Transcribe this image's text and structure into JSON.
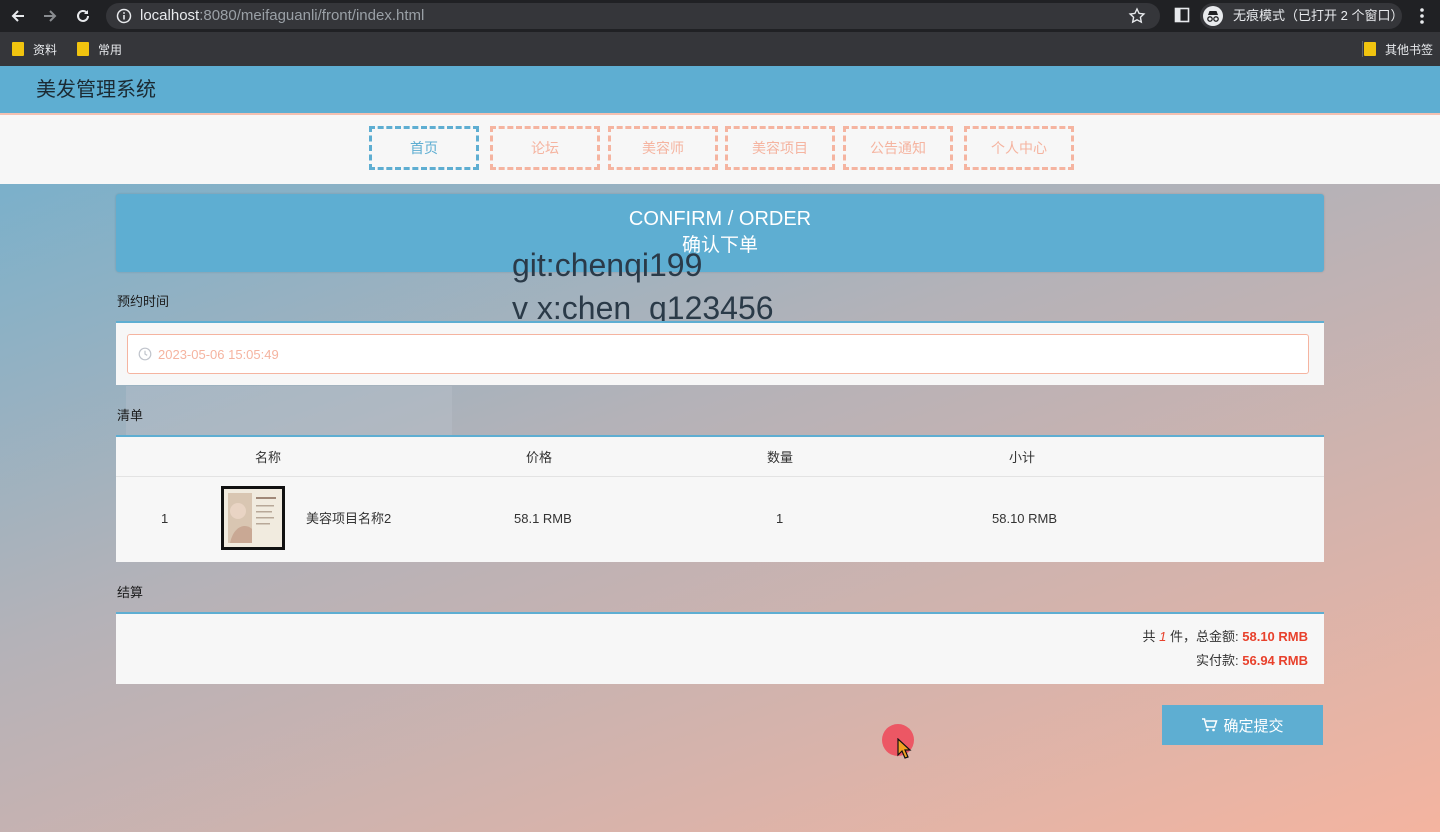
{
  "browser": {
    "url_host": "localhost",
    "url_rest": ":8080/meifaguanli/front/index.html",
    "incognito_label": "无痕模式（已打开 2 个窗口）",
    "bookmarks": [
      "资料",
      "常用"
    ],
    "other_bookmarks": "其他书签"
  },
  "site": {
    "title": "美发管理系统",
    "nav": [
      "首页",
      "论坛",
      "美容师",
      "美容项目",
      "公告通知",
      "个人中心"
    ]
  },
  "banner": {
    "en": "CONFIRM / ORDER",
    "cn": "确认下单"
  },
  "watermark": {
    "line1": "git:chenqi199",
    "line2": "v x:chen_q123456"
  },
  "appointment": {
    "label": "预约时间",
    "value": "2023-05-06 15:05:49"
  },
  "list": {
    "label": "清单",
    "headers": [
      "名称",
      "价格",
      "数量",
      "小计"
    ],
    "rows": [
      {
        "index": "1",
        "name": "美容项目名称2",
        "price": "58.1 RMB",
        "qty": "1",
        "subtotal": "58.10 RMB"
      }
    ]
  },
  "checkout": {
    "label": "结算",
    "prefix": "共",
    "count": "1",
    "mid": "件，总金额:",
    "total": "58.10 RMB",
    "actual_label": "实付款:",
    "actual": "56.94 RMB"
  },
  "submit_label": "确定提交",
  "colors": {
    "accent_blue": "#5eaed2",
    "accent_salmon": "#f5b4a0",
    "price_red": "#e8412c"
  }
}
